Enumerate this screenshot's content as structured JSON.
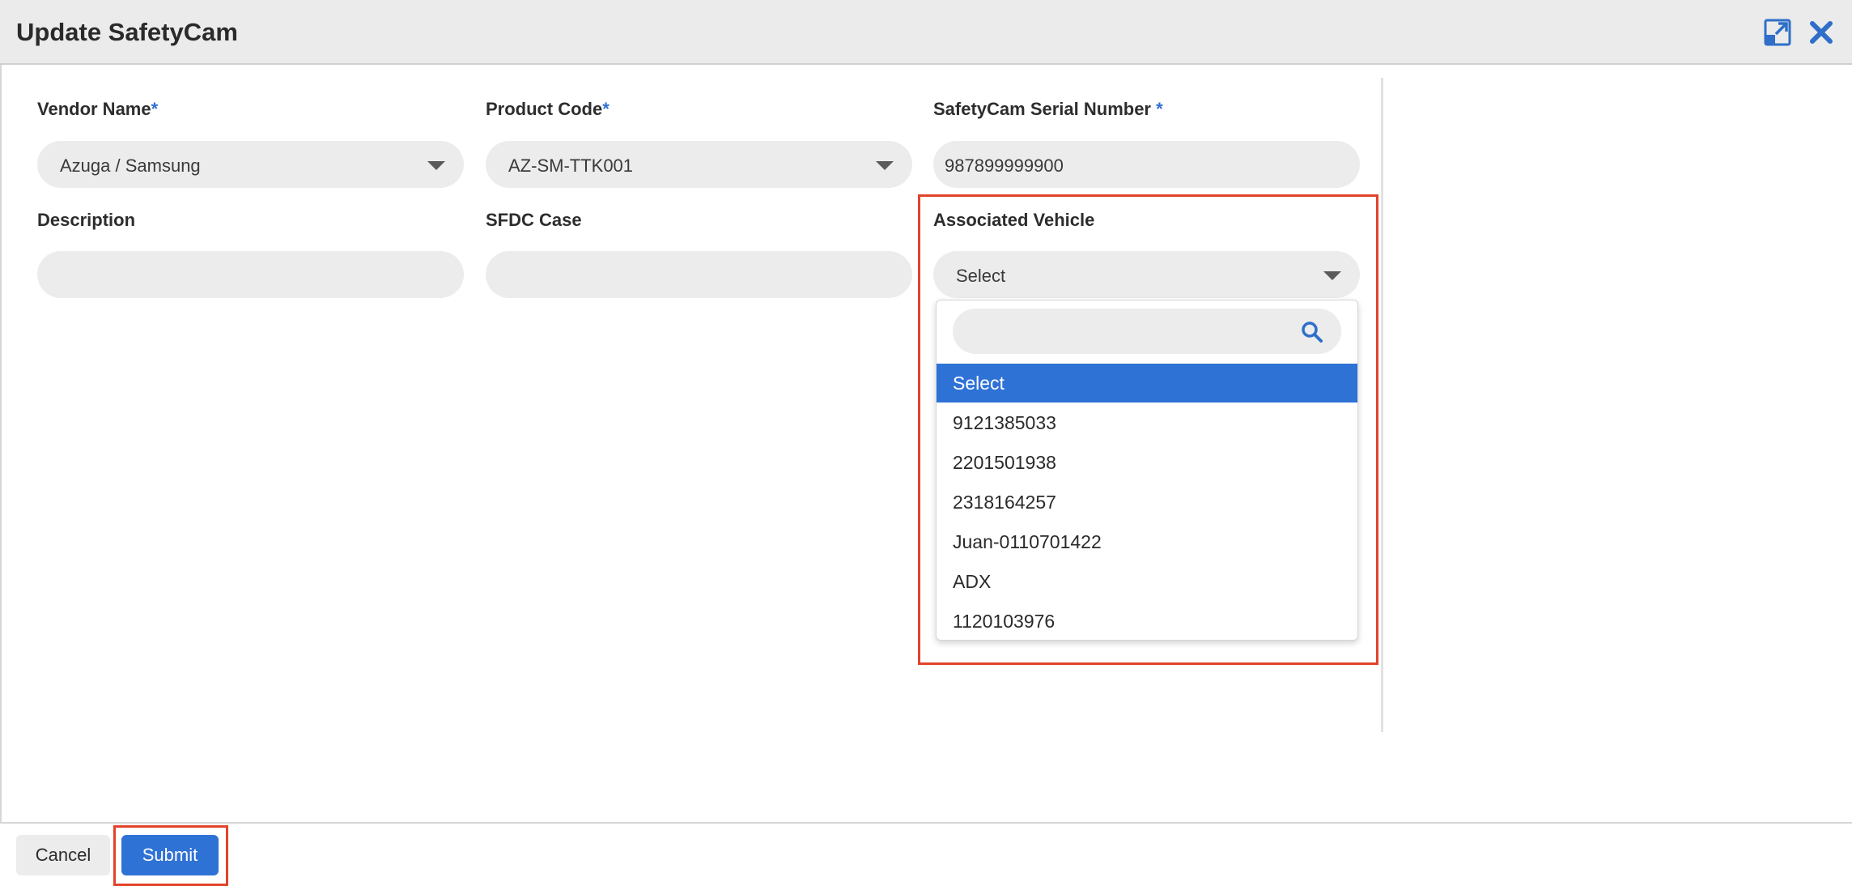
{
  "dialog": {
    "title": "Update SafetyCam"
  },
  "form": {
    "vendor": {
      "label": "Vendor Name",
      "required_mark": "*",
      "value": "Azuga / Samsung"
    },
    "product_code": {
      "label": "Product Code",
      "required_mark": "*",
      "value": "AZ-SM-TTK001"
    },
    "serial": {
      "label": "SafetyCam Serial Number ",
      "required_mark": "*",
      "value": "987899999900"
    },
    "description": {
      "label": "Description",
      "value": ""
    },
    "sfdc_case": {
      "label": "SFDC Case",
      "value": ""
    },
    "associated_vehicle": {
      "label": "Associated Vehicle",
      "value": "Select",
      "search_value": "",
      "options": [
        "Select",
        "9121385033",
        "2201501938",
        "2318164257",
        "Juan-0110701422",
        "ADX",
        "1120103976"
      ],
      "selected_index": 0
    }
  },
  "footer": {
    "cancel_label": "Cancel",
    "submit_label": "Submit"
  },
  "icons": {
    "expand": "expand-icon",
    "close": "close-icon",
    "search": "search-icon",
    "caret": "chevron-down-icon"
  },
  "colors": {
    "accent": "#2f72d6",
    "highlight": "#e2432a",
    "field_bg": "#ececec"
  }
}
